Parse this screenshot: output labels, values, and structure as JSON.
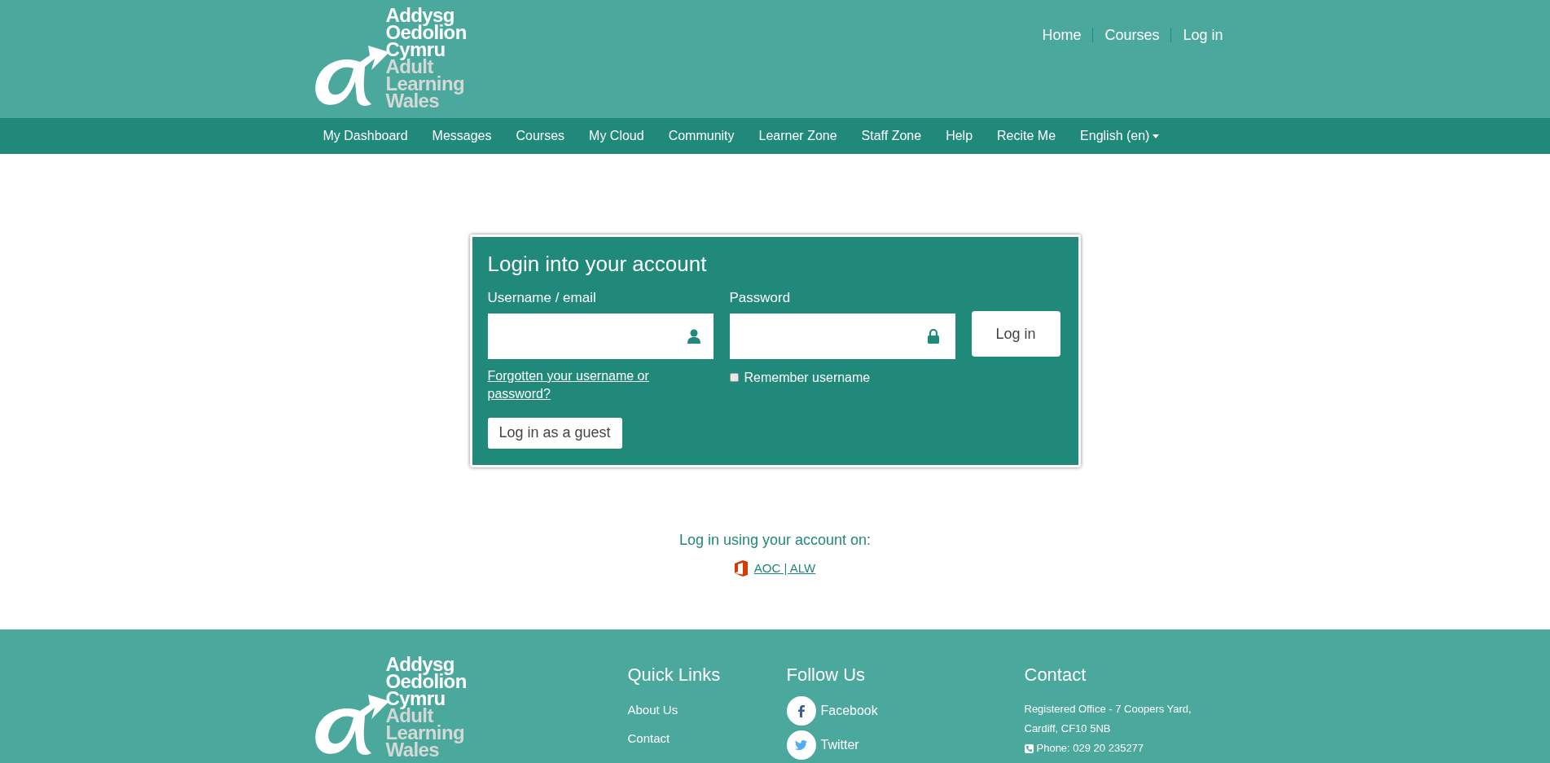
{
  "logo": {
    "welsh": [
      "Addysg",
      "Oedolion",
      "Cymru"
    ],
    "english": [
      "Adult",
      "Learning",
      "Wales"
    ]
  },
  "top_links": [
    "Home",
    "Courses",
    "Log in"
  ],
  "nav": [
    {
      "label": "My Dashboard",
      "kind": "link"
    },
    {
      "label": "Messages",
      "kind": "link"
    },
    {
      "label": "Courses",
      "kind": "link"
    },
    {
      "label": "My Cloud",
      "kind": "link"
    },
    {
      "label": "Community",
      "kind": "link"
    },
    {
      "label": "Learner Zone",
      "kind": "link"
    },
    {
      "label": "Staff Zone",
      "kind": "link"
    },
    {
      "label": "Help",
      "kind": "link"
    },
    {
      "label": "Recite Me",
      "kind": "link"
    },
    {
      "label": "English (en)",
      "kind": "dropdown"
    }
  ],
  "login": {
    "title": "Login into your account",
    "username_label": "Username / email",
    "password_label": "Password",
    "submit": "Log in",
    "forgot": "Forgotten your username or password?",
    "remember": {
      "label": "Remember username",
      "checked": false
    },
    "guest": "Log in as a guest"
  },
  "sso": {
    "prompt": "Log in using your account on:",
    "provider": "AOC | ALW"
  },
  "footer": {
    "logo": {
      "welsh": [
        "Addysg",
        "Oedolion",
        "Cymru"
      ],
      "english": [
        "Adult",
        "Learning",
        "Wales"
      ]
    },
    "quick_links": {
      "title": "Quick Links",
      "items": [
        "About Us",
        "Contact"
      ]
    },
    "follow": {
      "title": "Follow Us",
      "items": [
        {
          "label": "Facebook",
          "kind": "facebook"
        },
        {
          "label": "Twitter",
          "kind": "twitter"
        }
      ]
    },
    "contact": {
      "title": "Contact",
      "lines": [
        "Registered Office - 7 Coopers Yard,",
        "Cardiff, CF10 5NB"
      ],
      "phone": "Phone: 029 20 235277"
    }
  }
}
